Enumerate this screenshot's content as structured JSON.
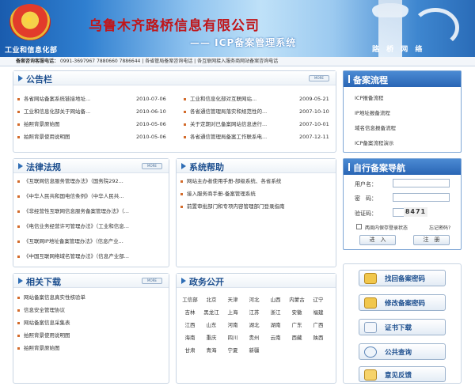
{
  "header": {
    "ministry": "工业和信息化部",
    "company": "乌鲁木齐路桥信息有限公司",
    "system": "—— ICP备案管理系统",
    "slogan": "路 桥 网 络"
  },
  "hotline": {
    "label": "备案咨询客服电话：",
    "phones": "0991-3697967 7880660 7886644",
    "link1": "各省管局备案咨询电话",
    "link2": "各互联网接入服务商网站备案咨询电话"
  },
  "more_label": "MORE",
  "notice": {
    "title": "公告栏",
    "left": [
      {
        "text": "各省网站备案系统链接地址...",
        "date": "2010-07-06"
      },
      {
        "text": "工业和信息化部关于网站备...",
        "date": "2010-06-10"
      },
      {
        "text": "拍照背景原始图",
        "date": "2010-05-06"
      },
      {
        "text": "拍照背景使用说明图",
        "date": "2010-05-06"
      }
    ],
    "right": [
      {
        "text": "工业和信息化部对互联网站...",
        "date": "2009-05-21"
      },
      {
        "text": "各省通信管理局落实和规范性的...",
        "date": "2007-10-10"
      },
      {
        "text": "关于定期对已备案网站信息进行...",
        "date": "2007-10-01"
      },
      {
        "text": "各省通信管理局备案工作联系电...",
        "date": "2007-12-11"
      }
    ]
  },
  "laws": {
    "title": "法律法规",
    "items": [
      "《互联网信息服务管理办法》（国务院292...",
      "《中华人民共和国电信条例》（中华人民共...",
      "《非经营性互联网信息服务备案管理办法》（...",
      "《电信业务经营许可管理办法》（工业和信息...",
      "《互联网IP地址备案管理办法》（信息产业...",
      "《中国互联网络域名管理办法》（信息产业部..."
    ]
  },
  "help": {
    "title": "系统帮助",
    "items": [
      "网站主办者使用手册-部级系统、各省系统",
      "接入服务商手册-备案管理系统",
      "前置审批部门和专项内容管理部门登录指南"
    ]
  },
  "downloads": {
    "title": "相关下载",
    "items": [
      "网站备案信息真实性核验单",
      "信息安全管理协议",
      "网站备案信息采集表",
      "拍照背景使用说明图",
      "拍照背景原始图"
    ]
  },
  "gov": {
    "title": "政务公开",
    "rows": [
      [
        "工信部",
        "北京",
        "天津",
        "河北",
        "山西",
        "内蒙古",
        "辽宁"
      ],
      [
        "吉林",
        "黑龙江",
        "上海",
        "江苏",
        "浙江",
        "安徽",
        "福建"
      ],
      [
        "江西",
        "山东",
        "河南",
        "湖北",
        "湖南",
        "广东",
        "广西"
      ],
      [
        "海南",
        "重庆",
        "四川",
        "贵州",
        "云南",
        "西藏",
        "陕西"
      ],
      [
        "甘肃",
        "青海",
        "宁夏",
        "新疆"
      ]
    ]
  },
  "flow": {
    "title": "备案流程",
    "items": [
      "ICP报备流程",
      "IP地址报备流程",
      "域名信息报备流程",
      "ICP备案流程演示"
    ]
  },
  "nav": {
    "title": "自行备案导航",
    "username_label": "用户名：",
    "password_label": "密　码：",
    "captcha_label": "验证码：",
    "captcha_text": "8471",
    "remember_label": "两周内保存登录状态",
    "forgot_label": "忘记密码?",
    "login_button": "进　入",
    "register_button": "注　册"
  },
  "services": [
    {
      "label": "找回备案密码",
      "icon": "key-icon"
    },
    {
      "label": "修改备案密码",
      "icon": "key-icon"
    },
    {
      "label": "证书下载",
      "icon": "document-icon"
    },
    {
      "label": "公共查询",
      "icon": "magnifier-icon"
    },
    {
      "label": "意见反馈",
      "icon": "pen-icon"
    }
  ]
}
